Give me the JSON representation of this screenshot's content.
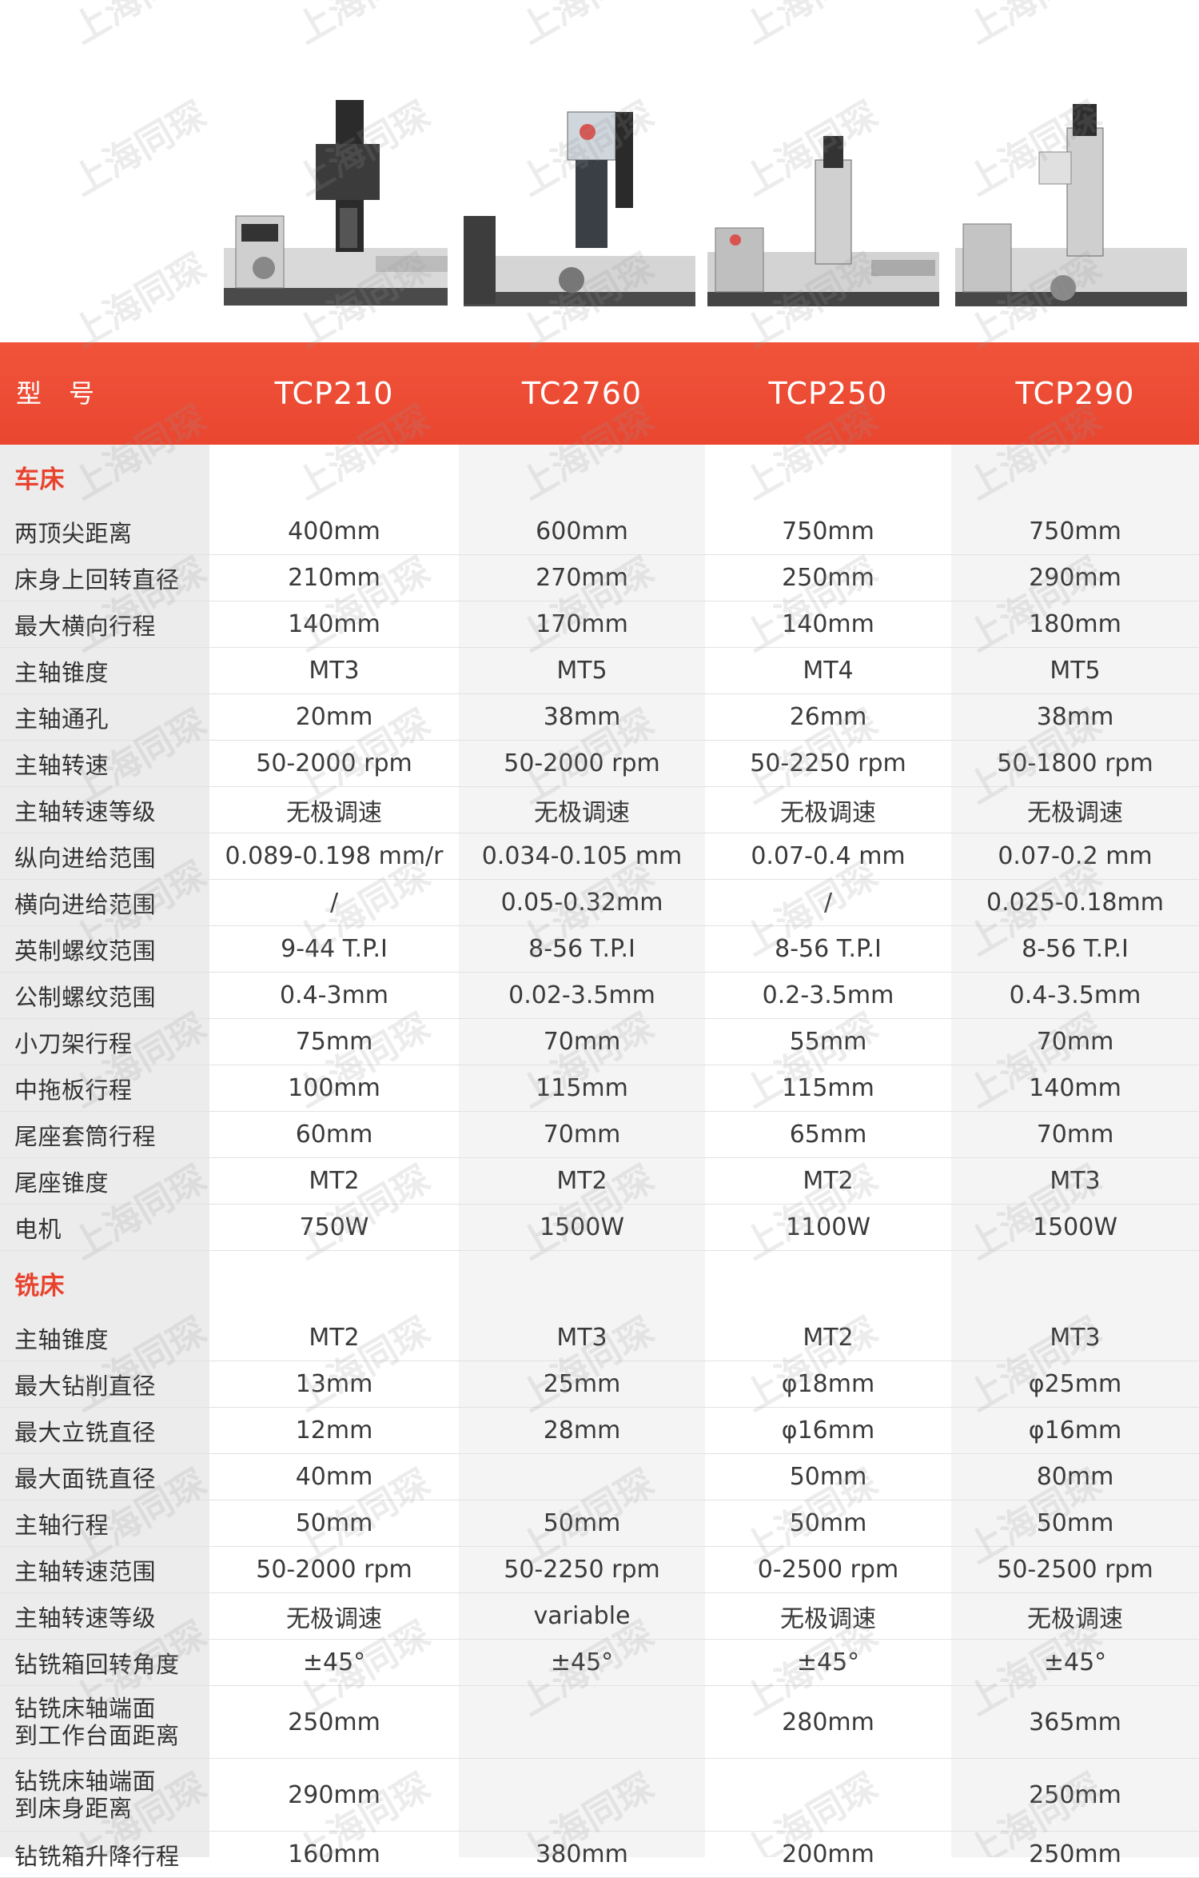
{
  "header": {
    "label": "型号",
    "models": [
      "TCP210",
      "TC2760",
      "TCP250",
      "TCP290"
    ]
  },
  "sections": [
    {
      "title": "车床",
      "rows": [
        {
          "label": "两顶尖距离",
          "values": [
            "400mm",
            "600mm",
            "750mm",
            "750mm"
          ]
        },
        {
          "label": "床身上回转直径",
          "values": [
            "210mm",
            "270mm",
            "250mm",
            "290mm"
          ]
        },
        {
          "label": "最大横向行程",
          "values": [
            "140mm",
            "170mm",
            "140mm",
            "180mm"
          ]
        },
        {
          "label": "主轴锥度",
          "values": [
            "MT3",
            "MT5",
            "MT4",
            "MT5"
          ]
        },
        {
          "label": "主轴通孔",
          "values": [
            "20mm",
            "38mm",
            "26mm",
            "38mm"
          ]
        },
        {
          "label": "主轴转速",
          "values": [
            "50-2000 rpm",
            "50-2000 rpm",
            "50-2250 rpm",
            "50-1800 rpm"
          ]
        },
        {
          "label": "主轴转速等级",
          "values": [
            "无极调速",
            "无极调速",
            "无极调速",
            "无极调速"
          ]
        },
        {
          "label": "纵向进给范围",
          "values": [
            "0.089-0.198 mm/r",
            "0.034-0.105 mm",
            "0.07-0.4 mm",
            "0.07-0.2 mm"
          ]
        },
        {
          "label": "横向进给范围",
          "values": [
            "/",
            "0.05-0.32mm",
            "/",
            "0.025-0.18mm"
          ]
        },
        {
          "label": "英制螺纹范围",
          "values": [
            "9-44 T.P.I",
            "8-56 T.P.I",
            "8-56 T.P.I",
            "8-56 T.P.I"
          ]
        },
        {
          "label": "公制螺纹范围",
          "values": [
            "0.4-3mm",
            "0.02-3.5mm",
            "0.2-3.5mm",
            "0.4-3.5mm"
          ]
        },
        {
          "label": "小刀架行程",
          "values": [
            "75mm",
            "70mm",
            "55mm",
            "70mm"
          ]
        },
        {
          "label": "中拖板行程",
          "values": [
            "100mm",
            "115mm",
            "115mm",
            "140mm"
          ]
        },
        {
          "label": "尾座套筒行程",
          "values": [
            "60mm",
            "70mm",
            "65mm",
            "70mm"
          ]
        },
        {
          "label": "尾座锥度",
          "values": [
            "MT2",
            "MT2",
            "MT2",
            "MT3"
          ]
        },
        {
          "label": "电机",
          "values": [
            "750W",
            "1500W",
            "1100W",
            "1500W"
          ]
        }
      ]
    },
    {
      "title": "铣床",
      "rows": [
        {
          "label": "主轴锥度",
          "values": [
            "MT2",
            "MT3",
            "MT2",
            "MT3"
          ]
        },
        {
          "label": "最大钻削直径",
          "values": [
            "13mm",
            "25mm",
            "φ18mm",
            "φ25mm"
          ]
        },
        {
          "label": "最大立铣直径",
          "values": [
            "12mm",
            "28mm",
            "φ16mm",
            "φ16mm"
          ]
        },
        {
          "label": "最大面铣直径",
          "values": [
            "40mm",
            "",
            "50mm",
            "80mm"
          ]
        },
        {
          "label": "主轴行程",
          "values": [
            "50mm",
            "50mm",
            "50mm",
            "50mm"
          ]
        },
        {
          "label": "主轴转速范围",
          "values": [
            "50-2000 rpm",
            "50-2250 rpm",
            "0-2500 rpm",
            "50-2500 rpm"
          ]
        },
        {
          "label": "主轴转速等级",
          "values": [
            "无极调速",
            "variable",
            "无极调速",
            "无极调速"
          ]
        },
        {
          "label": "钻铣箱回转角度",
          "values": [
            "±45°",
            "±45°",
            "±45°",
            "±45°"
          ]
        },
        {
          "label_lines": [
            "钻铣床轴端面",
            "到工作台面距离"
          ],
          "values": [
            "250mm",
            "",
            "280mm",
            "365mm"
          ]
        },
        {
          "label_lines": [
            "钻铣床轴端面",
            "到床身距离"
          ],
          "values": [
            "290mm",
            "",
            "",
            "250mm"
          ]
        },
        {
          "label": "钻铣箱升降行程",
          "values": [
            "160mm",
            "380mm",
            "200mm",
            "250mm"
          ]
        }
      ]
    }
  ],
  "watermark": "上海同琛",
  "colors": {
    "accent": "#ea4630",
    "section_title": "#e8432e"
  }
}
